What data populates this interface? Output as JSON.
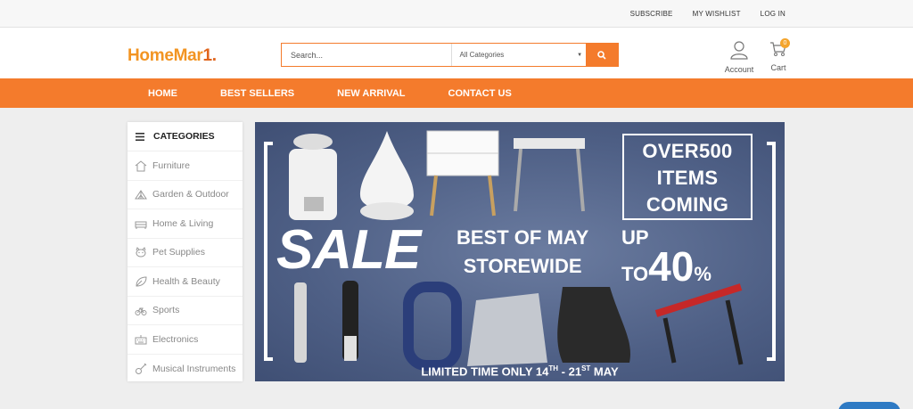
{
  "topbar": {
    "subscribe": "SUBSCRIBE",
    "wishlist": "MY WISHLIST",
    "login": "LOG IN"
  },
  "header": {
    "logo": {
      "text_main": "HomeMar",
      "text_accent": "1",
      "dot": "."
    },
    "search": {
      "placeholder": "Search...",
      "category": "All Categories"
    },
    "account_label": "Account",
    "cart_label": "Cart",
    "cart_count": "0"
  },
  "nav": {
    "home": "HOME",
    "best_sellers": "BEST SELLERS",
    "new_arrival": "NEW ARRIVAL",
    "contact_us": "CONTACT US"
  },
  "sidebar": {
    "title": "CATEGORIES",
    "items": [
      {
        "label": "Furniture",
        "icon": "house-icon"
      },
      {
        "label": "Garden & Outdoor",
        "icon": "tent-icon"
      },
      {
        "label": "Home & Living",
        "icon": "sofa-icon"
      },
      {
        "label": "Pet Supplies",
        "icon": "pet-icon"
      },
      {
        "label": "Health & Beauty",
        "icon": "leaf-icon"
      },
      {
        "label": "Sports",
        "icon": "bicycle-icon"
      },
      {
        "label": "Electronics",
        "icon": "keyboard-icon"
      },
      {
        "label": "Musical Instruments",
        "icon": "guitar-icon"
      }
    ]
  },
  "banner": {
    "offer_line1": "OVER500",
    "offer_line2": "ITEMS",
    "offer_line3": "COMING",
    "sale": "SALE",
    "best_line1": "BEST OF MAY",
    "best_line2": "STOREWIDE",
    "up": "UP",
    "to": "TO",
    "percent_value": "40",
    "percent_sign": "%",
    "limited_prefix": "LIMITED TIME ONLY 14",
    "limited_sup1": "TH",
    "limited_mid": " - 21",
    "limited_sup2": "ST",
    "limited_suffix": " MAY"
  },
  "colors": {
    "accent": "#f47b2c",
    "logo": "#f29422",
    "banner_bg": "#4e5f85",
    "badge": "#f4a42c",
    "chat": "#2e7ac4"
  }
}
